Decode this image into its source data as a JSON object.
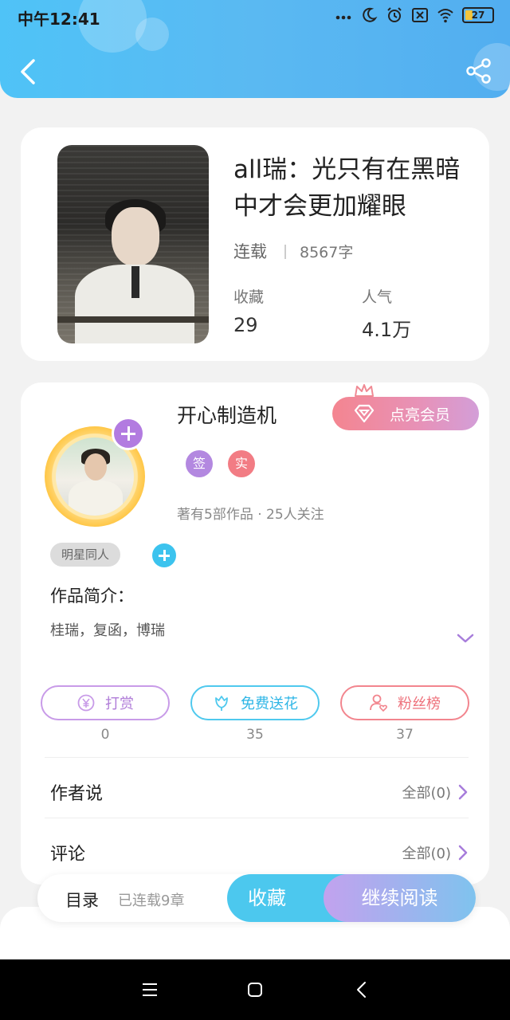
{
  "status_bar": {
    "time": "中午12:41",
    "battery": "27"
  },
  "book": {
    "title": "all瑞：光只有在黑暗中才会更加耀眼",
    "status": "连载",
    "word_count": "8567字",
    "favorites_label": "收藏",
    "favorites_value": "29",
    "popularity_label": "人气",
    "popularity_value": "4.1万"
  },
  "author": {
    "name": "开心制造机",
    "vip_button": "点亮会员",
    "badge_sign": "签",
    "badge_real": "实",
    "meta": "著有5部作品 · 25人关注",
    "tag": "明星同人"
  },
  "intro": {
    "title": "作品简介：",
    "text": "桂瑞，复函，博瑞"
  },
  "actions": [
    {
      "label": "打赏",
      "count": "0",
      "color": "#c89be8"
    },
    {
      "label": "免费送花",
      "count": "35",
      "color": "#4fc9ee"
    },
    {
      "label": "粉丝榜",
      "count": "37",
      "color": "#f2858e"
    }
  ],
  "rows": {
    "author_says": "作者说",
    "author_says_right": "全部(0)",
    "comments": "评论",
    "comments_right": "全部(0)"
  },
  "bottom_bar": {
    "toc": "目录",
    "toc_sub": "已连载9章",
    "collect": "收藏",
    "continue": "继续阅读"
  },
  "colors": {
    "header": "#52b8f2",
    "accent_purple": "#b27be0",
    "accent_cyan": "#4cc8ee",
    "accent_pink": "#f2858e"
  }
}
